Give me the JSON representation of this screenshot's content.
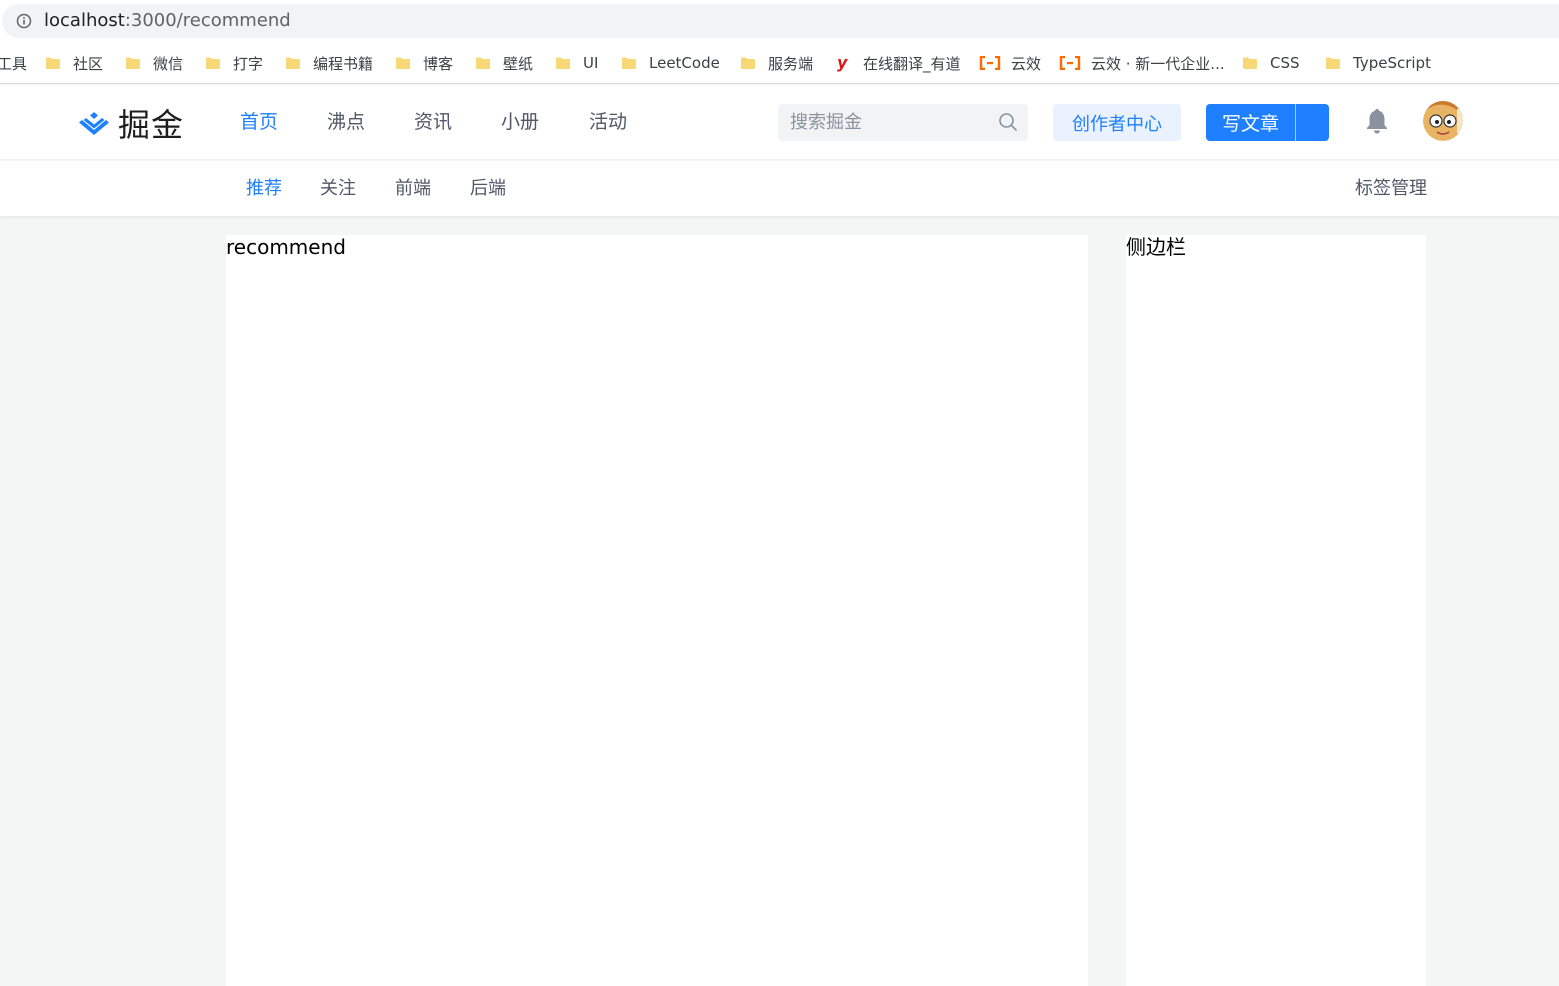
{
  "browser": {
    "url_host": "localhost",
    "url_rest": ":3000/recommend"
  },
  "bookmarks": [
    {
      "label": "工具",
      "icon": "none"
    },
    {
      "label": "社区",
      "icon": "folder-icon"
    },
    {
      "label": "微信",
      "icon": "folder-icon"
    },
    {
      "label": "打字",
      "icon": "folder-icon"
    },
    {
      "label": "编程书籍",
      "icon": "folder-icon"
    },
    {
      "label": "博客",
      "icon": "folder-icon"
    },
    {
      "label": "壁纸",
      "icon": "folder-icon"
    },
    {
      "label": "UI",
      "icon": "folder-icon"
    },
    {
      "label": "LeetCode",
      "icon": "folder-icon"
    },
    {
      "label": "服务端",
      "icon": "folder-icon"
    },
    {
      "label": "在线翻译_有道",
      "icon": "youdao-icon"
    },
    {
      "label": "云效",
      "icon": "yunxiao-icon"
    },
    {
      "label": "云效 · 新一代企业...",
      "icon": "yunxiao-icon"
    },
    {
      "label": "CSS",
      "icon": "folder-icon"
    },
    {
      "label": "TypeScript",
      "icon": "folder-icon"
    }
  ],
  "header": {
    "logo_text": "掘金",
    "nav": [
      {
        "label": "首页",
        "active": true
      },
      {
        "label": "沸点",
        "active": false
      },
      {
        "label": "资讯",
        "active": false
      },
      {
        "label": "小册",
        "active": false
      },
      {
        "label": "活动",
        "active": false
      }
    ],
    "search_placeholder": "搜索掘金",
    "creator_label": "创作者中心",
    "write_label": "写文章"
  },
  "sub_nav": {
    "items": [
      {
        "label": "推荐",
        "active": true
      },
      {
        "label": "关注",
        "active": false
      },
      {
        "label": "前端",
        "active": false
      },
      {
        "label": "后端",
        "active": false
      }
    ],
    "tag_manage": "标签管理"
  },
  "main": {
    "content_text": "recommend"
  },
  "sidebar": {
    "content_text": "侧边栏"
  },
  "colors": {
    "accent": "#1e80ff",
    "page_bg": "#f4f5f5"
  }
}
